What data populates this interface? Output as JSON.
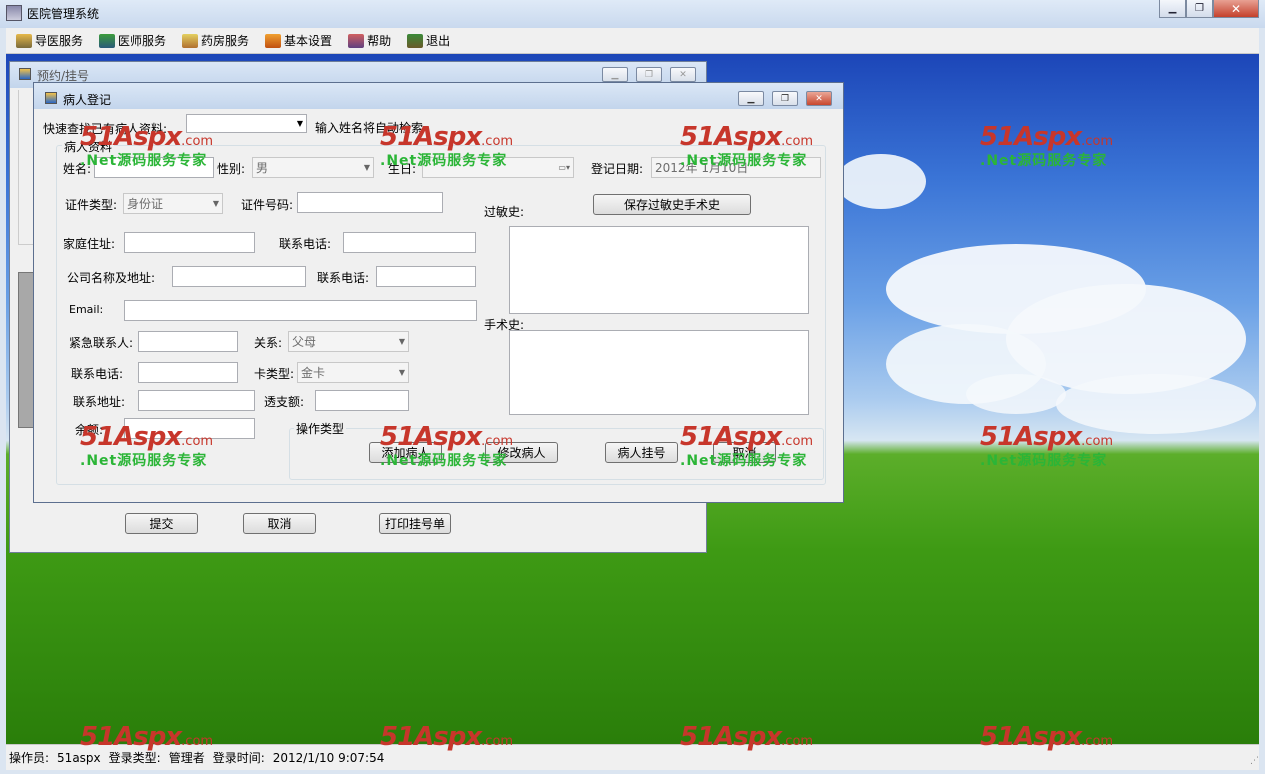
{
  "app": {
    "title": "医院管理系统"
  },
  "menu": [
    {
      "label": "导医服务",
      "icon": "guide-icon"
    },
    {
      "label": "医师服务",
      "icon": "doctor-icon"
    },
    {
      "label": "药房服务",
      "icon": "pharmacy-icon"
    },
    {
      "label": "基本设置",
      "icon": "settings-icon"
    },
    {
      "label": "帮助",
      "icon": "help-icon"
    },
    {
      "label": "退出",
      "icon": "exit-icon"
    }
  ],
  "window_buttons": {
    "minimize": "▁",
    "restore": "❐",
    "close": "✕"
  },
  "booking_window": {
    "title": "预约/挂号",
    "buttons": {
      "submit": "提交",
      "cancel": "取消",
      "print": "打印挂号单"
    }
  },
  "patient_window": {
    "title": "病人登记",
    "quick_search_label": "快速查找已有病人资料:",
    "quick_search_value": "",
    "quick_search_hint": "输入姓名将自动检索",
    "group_title": "病人资料",
    "fields": {
      "name_label": "姓名:",
      "gender_label": "性别:",
      "gender_value": "男",
      "birthday_label": "生日:",
      "reg_date_label": "登记日期:",
      "reg_date_value": "2012年 1月10日",
      "id_type_label": "证件类型:",
      "id_type_value": "身份证",
      "id_no_label": "证件号码:",
      "address_label": "家庭住址:",
      "phone_label": "联系电话:",
      "company_label": "公司名称及地址:",
      "company_phone_label": "联系电话:",
      "email_label": "Email:",
      "emergency_label": "紧急联系人:",
      "relation_label": "关系:",
      "relation_value": "父母",
      "emergency_phone_label": "联系电话:",
      "card_type_label": "卡类型:",
      "card_type_value": "金卡",
      "contact_address_label": "联系地址:",
      "overdraft_label": "透支额:",
      "balance_label": "余额:",
      "allergy_label": "过敏史:",
      "surgery_label": "手术史:"
    },
    "save_history_button": "保存过敏史手术史",
    "operation_group_title": "操作类型",
    "operation_buttons": {
      "add": "添加病人",
      "edit": "修改病人",
      "register": "病人挂号",
      "cancel": "取消"
    }
  },
  "status_bar": {
    "operator_label": "操作员:",
    "operator": "51aspx",
    "login_type_label": "登录类型:",
    "login_type": "管理者",
    "login_time_label": "登录时间:",
    "login_time": "2012/1/10 9:07:54"
  },
  "watermark": {
    "brand": "51Aspx",
    "domain": ".com",
    "slogan": ".Net源码服务专家"
  }
}
